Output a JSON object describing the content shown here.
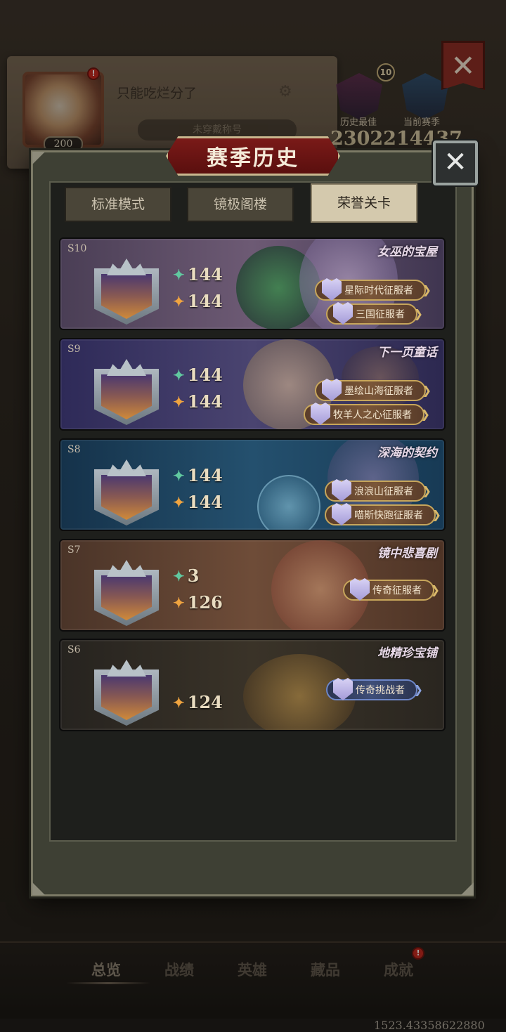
{
  "profile": {
    "nickname": "只能吃烂分了",
    "title_placeholder": "未穿戴称号",
    "level": "200",
    "best_label": "历史最佳",
    "current_label": "当前赛季",
    "best_score": "23022",
    "current_score": "14437",
    "badge_count": "10"
  },
  "modal": {
    "title": "赛季历史",
    "close_label": "✕",
    "tabs": [
      {
        "label": "标准模式",
        "active": false
      },
      {
        "label": "镜极阁楼",
        "active": false
      },
      {
        "label": "荣誉关卡",
        "active": true
      }
    ]
  },
  "seasons": [
    {
      "season": "S10",
      "art_title": "女巫的宝屋",
      "green_score": "144",
      "gold_score": "144",
      "achievements": [
        "星际时代征服者",
        "三国征服者"
      ],
      "theme_color": "#5a4a6a"
    },
    {
      "season": "S9",
      "art_title": "下一页童话",
      "green_score": "144",
      "gold_score": "144",
      "achievements": [
        "墨绘山海征服者",
        "牧羊人之心征服者"
      ],
      "theme_color": "#3a3468"
    },
    {
      "season": "S8",
      "art_title": "深海的契约",
      "green_score": "144",
      "gold_score": "144",
      "achievements": [
        "浪浪山征服者",
        "喵斯快跑征服者"
      ],
      "theme_color": "#1f4a66"
    },
    {
      "season": "S7",
      "art_title": "镜中悲喜剧",
      "green_score": "3",
      "gold_score": "126",
      "achievements": [
        "传奇征服者"
      ],
      "theme_color": "#6a4632"
    },
    {
      "season": "S6",
      "art_title": "地精珍宝铺",
      "green_score": "",
      "gold_score": "124",
      "achievements": [
        "传奇挑战者"
      ],
      "theme_color": "#2e2e2a"
    }
  ],
  "nav": {
    "items": [
      "总览",
      "战绩",
      "英雄",
      "藏品",
      "成就"
    ],
    "active": "总览"
  },
  "footer": {
    "coords": "1523.43358622880"
  },
  "icons": {
    "green_star": "sparkle-green-icon",
    "gold_star": "sparkle-gold-icon",
    "close": "close-icon",
    "gear": "gear-icon"
  }
}
